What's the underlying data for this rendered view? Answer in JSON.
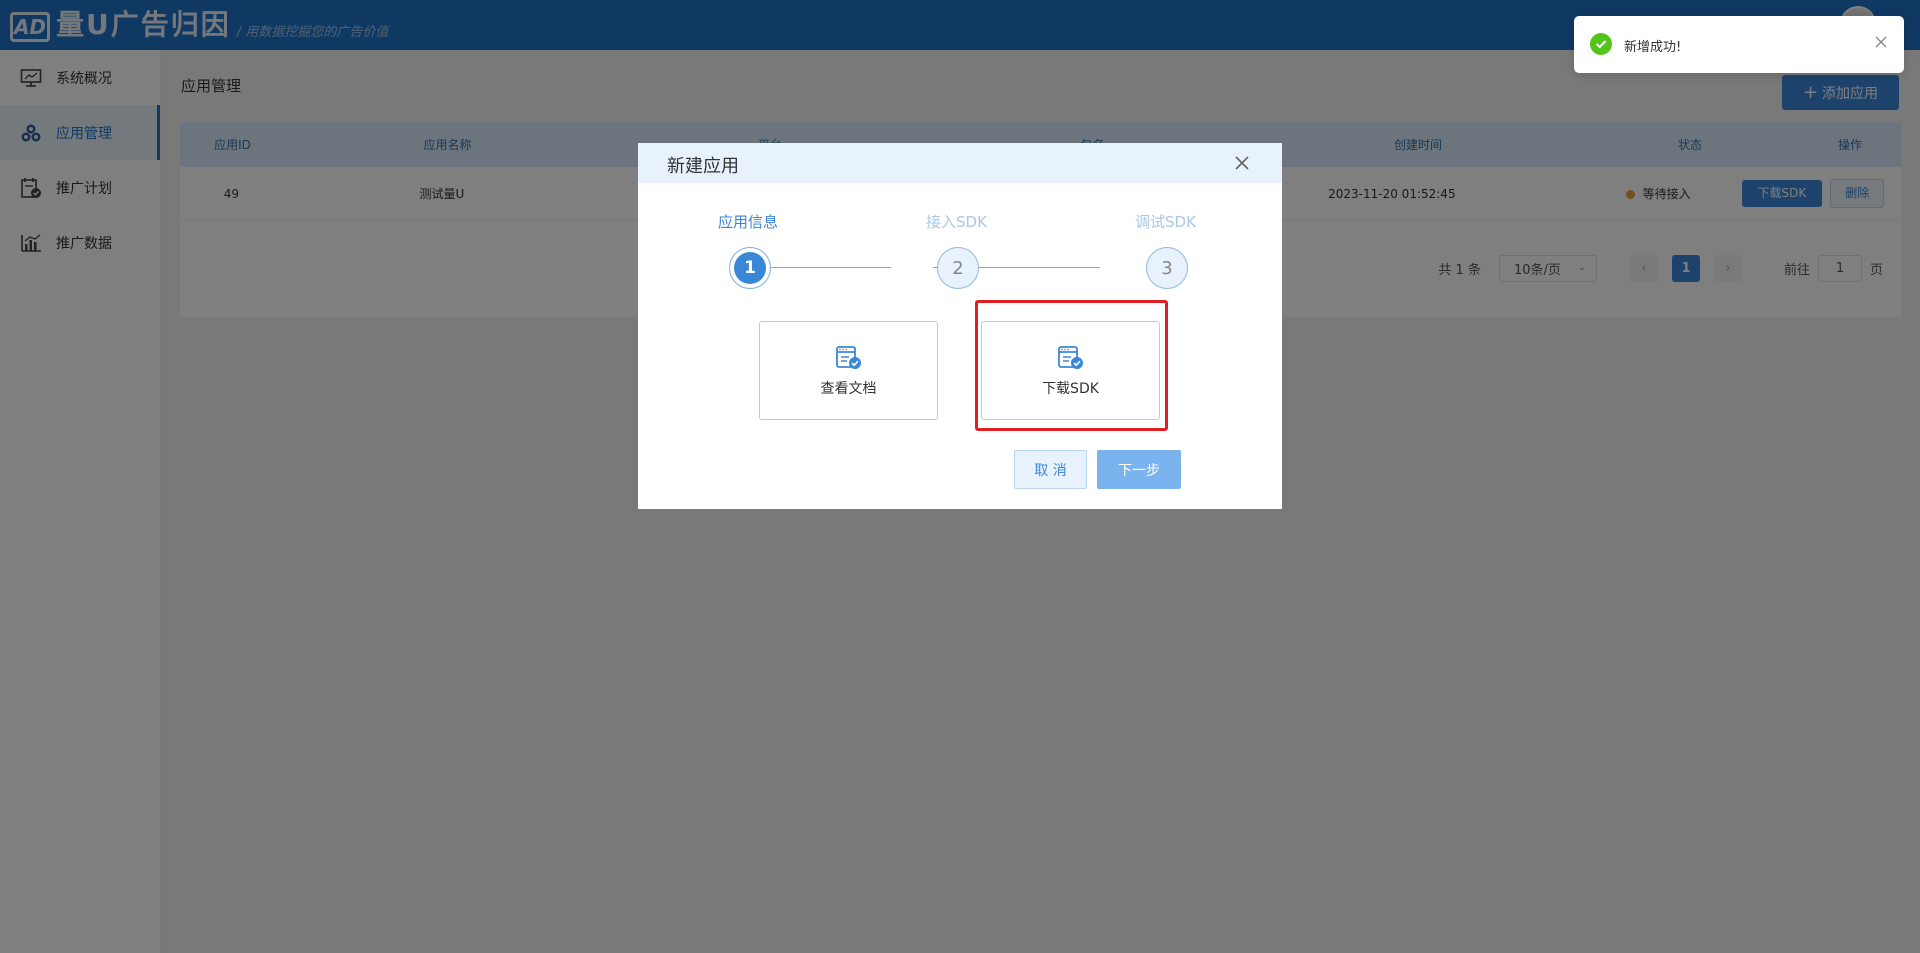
{
  "header": {
    "logo_badge": "AD",
    "logo_name": "量U广告归因",
    "slogan": "/ 用数据挖掘您的广告价值"
  },
  "sidebar": {
    "items": [
      {
        "label": "系统概况",
        "icon": "monitor-icon"
      },
      {
        "label": "应用管理",
        "icon": "apps-icon",
        "active": true
      },
      {
        "label": "推广计划",
        "icon": "plan-icon"
      },
      {
        "label": "推广数据",
        "icon": "chart-icon"
      }
    ]
  },
  "main": {
    "title": "应用管理",
    "add_button": "添加应用",
    "table": {
      "headers": [
        "应用ID",
        "应用名称",
        "平台",
        "包名",
        "创建时间",
        "状态",
        "操作"
      ],
      "rows": [
        {
          "id": "49",
          "name": "测试量U",
          "platform": "",
          "package": "",
          "created": "2023-11-20 01:52:45",
          "status": "等待接入",
          "download": "下载SDK",
          "delete": "删除"
        }
      ]
    },
    "pagination": {
      "total": "共 1 条",
      "page_size": "10条/页",
      "current": "1",
      "goto_prefix": "前往",
      "goto_value": "1",
      "goto_suffix": "页"
    }
  },
  "modal": {
    "title": "新建应用",
    "steps": [
      {
        "label": "应用信息",
        "number": "1"
      },
      {
        "label": "接入SDK",
        "number": "2"
      },
      {
        "label": "调试SDK",
        "number": "3"
      }
    ],
    "options": [
      {
        "label": "查看文档",
        "icon": "document-check-icon"
      },
      {
        "label": "下载SDK",
        "icon": "document-check-icon"
      }
    ],
    "cancel": "取 消",
    "next": "下一步"
  },
  "toast": {
    "message": "新增成功!"
  },
  "colors": {
    "brand": "#1f72c7",
    "primary": "#3a87d8",
    "success": "#52c41a",
    "warning": "#e6a23c",
    "highlight": "#e02020"
  }
}
